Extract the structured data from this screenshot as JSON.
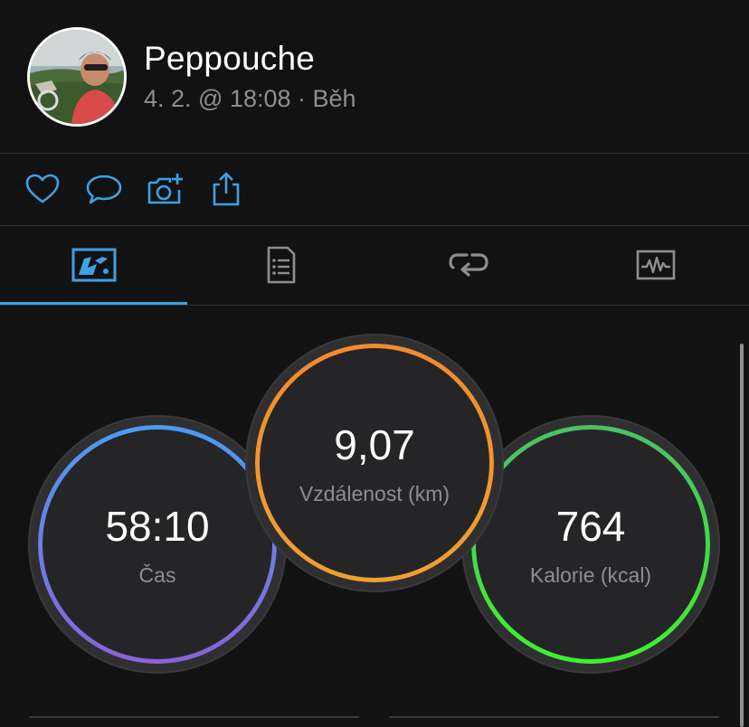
{
  "header": {
    "user_name": "Peppouche",
    "activity_meta": "4. 2. @ 18:08 · Běh"
  },
  "actions": {
    "icons": [
      "heart-icon",
      "comment-icon",
      "add-photo-icon",
      "share-icon"
    ],
    "accent_color": "#3ea0e6"
  },
  "tabs": {
    "icons": [
      "stats-icon",
      "details-icon",
      "laps-icon",
      "charts-icon"
    ],
    "selected_index": 0
  },
  "stats": {
    "time": {
      "value": "58:10",
      "label": "Čas",
      "ring_colors": [
        "#4a9cf0",
        "#8a62d8"
      ]
    },
    "distance": {
      "value": "9,07",
      "label": "Vzdálenost (km)",
      "ring_colors": [
        "#f28a2e",
        "#f0a030"
      ]
    },
    "calories": {
      "value": "764",
      "label": "Kalorie (kcal)",
      "ring_colors": [
        "#4cbf66",
        "#3ff02e"
      ]
    }
  }
}
